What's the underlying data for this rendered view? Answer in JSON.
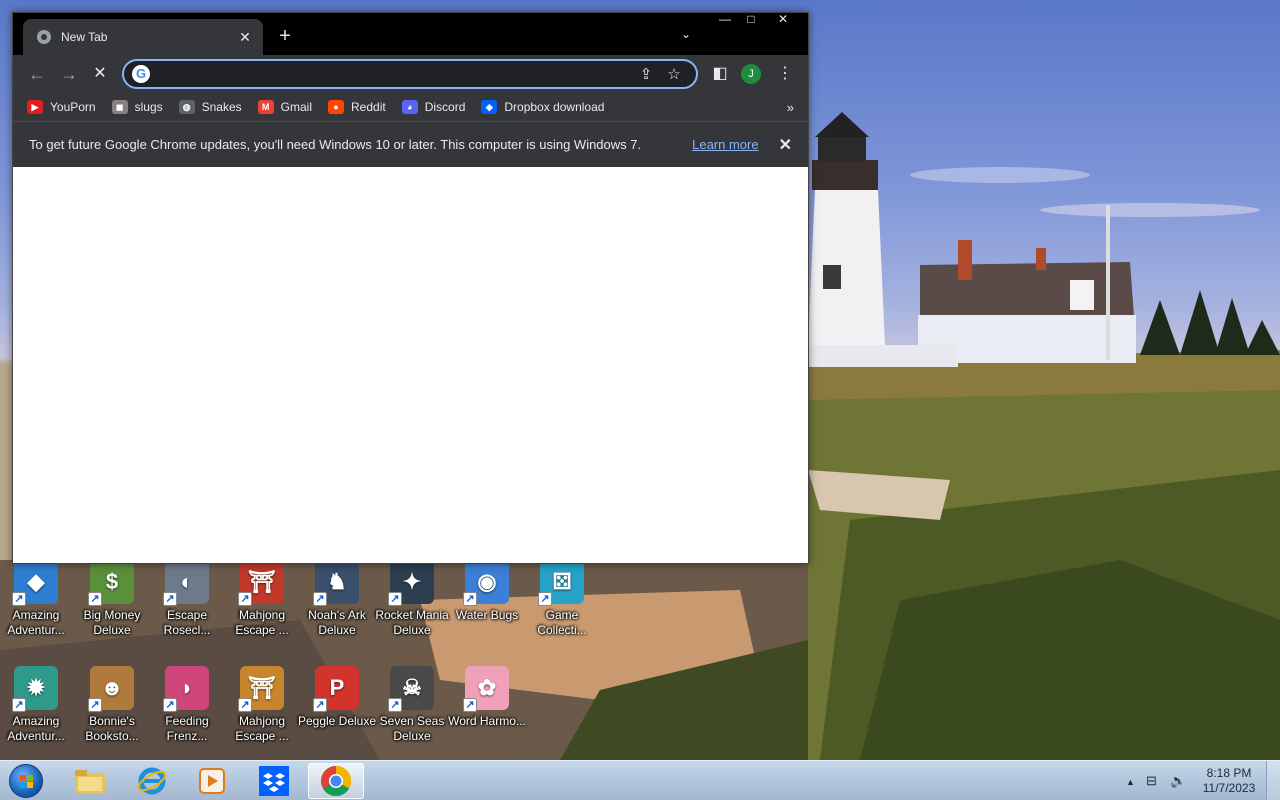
{
  "desktop": {
    "icons_row1": [
      {
        "label": "Amazing Adventur...",
        "color": "#2f7dd1",
        "glyph": "◆"
      },
      {
        "label": "Big Money Deluxe",
        "color": "#5a8f3c",
        "glyph": "$"
      },
      {
        "label": "Escape Rosecl...",
        "color": "#6c7a8c",
        "glyph": "◐"
      },
      {
        "label": "Mahjong Escape ...",
        "color": "#c0392b",
        "glyph": "⛩"
      },
      {
        "label": "Noah's Ark Deluxe",
        "color": "#3a4f6b",
        "glyph": "♞"
      },
      {
        "label": "Rocket Mania Deluxe",
        "color": "#2c3e50",
        "glyph": "✦"
      },
      {
        "label": "Water Bugs",
        "color": "#3c7fd6",
        "glyph": "◉"
      },
      {
        "label": "Game Collecti...",
        "color": "#27a2c8",
        "glyph": "⚄"
      }
    ],
    "icons_row2": [
      {
        "label": "Amazing Adventur...",
        "color": "#2f9a8a",
        "glyph": "✹"
      },
      {
        "label": "Bonnie's Booksto...",
        "color": "#b07a3c",
        "glyph": "☻"
      },
      {
        "label": "Feeding Frenz...",
        "color": "#d0457a",
        "glyph": "◗"
      },
      {
        "label": "Mahjong Escape ...",
        "color": "#c8862c",
        "glyph": "⛩"
      },
      {
        "label": "Peggle Deluxe",
        "color": "#d2342c",
        "glyph": "P"
      },
      {
        "label": "Seven Seas Deluxe",
        "color": "#4a4a4a",
        "glyph": "☠"
      },
      {
        "label": "Word Harmo...",
        "color": "#f0a0b8",
        "glyph": "✿"
      }
    ]
  },
  "browser": {
    "tab_title": "New Tab",
    "new_tab": "+",
    "tab_search": "⌄",
    "window_controls": {
      "minimize": "—",
      "maximize": "□",
      "close": "✕"
    },
    "nav": {
      "back": "←",
      "forward": "→",
      "stop": "✕"
    },
    "omnibox": {
      "value": "",
      "placeholder": "",
      "g_logo": "G"
    },
    "toolbar_icons": {
      "share": "⇪",
      "star": "☆",
      "sidepanel": "◧",
      "menu": "⋮"
    },
    "profile_initial": "J",
    "bookmarks": [
      {
        "label": "YouPorn",
        "color": "#e02020",
        "glyph": "▶"
      },
      {
        "label": "slugs",
        "color": "#8a7f84",
        "glyph": "◼"
      },
      {
        "label": "Snakes",
        "color": "#5f6368",
        "glyph": "◍"
      },
      {
        "label": "Gmail",
        "color": "#ea4335",
        "glyph": "M"
      },
      {
        "label": "Reddit",
        "color": "#ff4500",
        "glyph": "●"
      },
      {
        "label": "Discord",
        "color": "#5865f2",
        "glyph": "◕"
      },
      {
        "label": "Dropbox download",
        "color": "#0061fe",
        "glyph": "◆"
      }
    ],
    "bookmarks_more": "»",
    "infobar": {
      "message": "To get future Google Chrome updates, you'll need Windows 10 or later. This computer is using Windows 7.",
      "link": "Learn more",
      "close": "✕"
    }
  },
  "taskbar": {
    "time": "8:18 PM",
    "date": "11/7/2023",
    "tray": {
      "arrow": "▲",
      "network": "⊟",
      "volume": "🔈"
    }
  }
}
